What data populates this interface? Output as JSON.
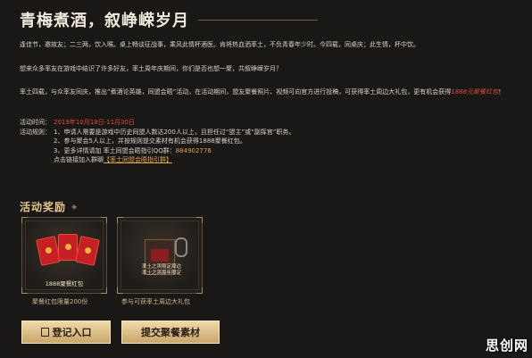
{
  "title": "青梅煮酒，叙峥嵘岁月",
  "intro": "逢佳节，邀故友；二三两，饮入喉。桌上畅谈征战事，乘风此情杯酒医。肯将热血洒率土，不负青春年少时。今四载，同桌庆；此生情，杯中饮。",
  "question": "想来众多率友在游戏中结识了许多好友，率土周年庆期间，你们是否也想一聚，共叙峥嵘岁月？",
  "description": {
    "text_before": "率土四载，与众率友同庆，推出“煮酒论英雄，同盟会晤”活动，在活动期间，盟友聚餐照片、视频可向官方进行投稿，可获得率土周边大礼包，更有机会获得",
    "highlight": "1888元聚餐红包",
    "text_after": "！"
  },
  "rules": {
    "time_label": "活动时间：",
    "time_value": "2019年10月18日-11月30日",
    "rules_label": "活动规则：",
    "rule_1": "1、申请人需要是游戏中历史同盟人数达200人以上，且担任过“盟主”或“副挥官”职务。",
    "rule_2": "2、参与聚会5人以上，并按规则提交素材有机会获得1888聚餐红包。",
    "rule_3_text": "3、更多详情请加 率土同盟会晤指引QQ群：",
    "rule_3_qq": "884902776",
    "rule_4_text": "点击链接加入群聊",
    "rule_4_link": "【率土同盟会晤指引群】"
  },
  "rewards": {
    "section_title": "活动奖励",
    "section_icon": "double-chevron-icon",
    "card1_caption": "1888聚餐红包",
    "card1_note": "聚餐红包限量200份",
    "card2_box_text_1": "率土之滨限定周边",
    "card2_box_text_2": "率土之滨周年限定",
    "card2_note": "参与可获率土周边大礼包"
  },
  "buttons": {
    "login": "登记入口",
    "submit": "提交聚餐素材"
  },
  "watermark": "思创网",
  "colors": {
    "background": "#1a1816",
    "accent_red": "#e04a3c",
    "accent_orange": "#e2a24d",
    "gold": "#c9a76b"
  }
}
